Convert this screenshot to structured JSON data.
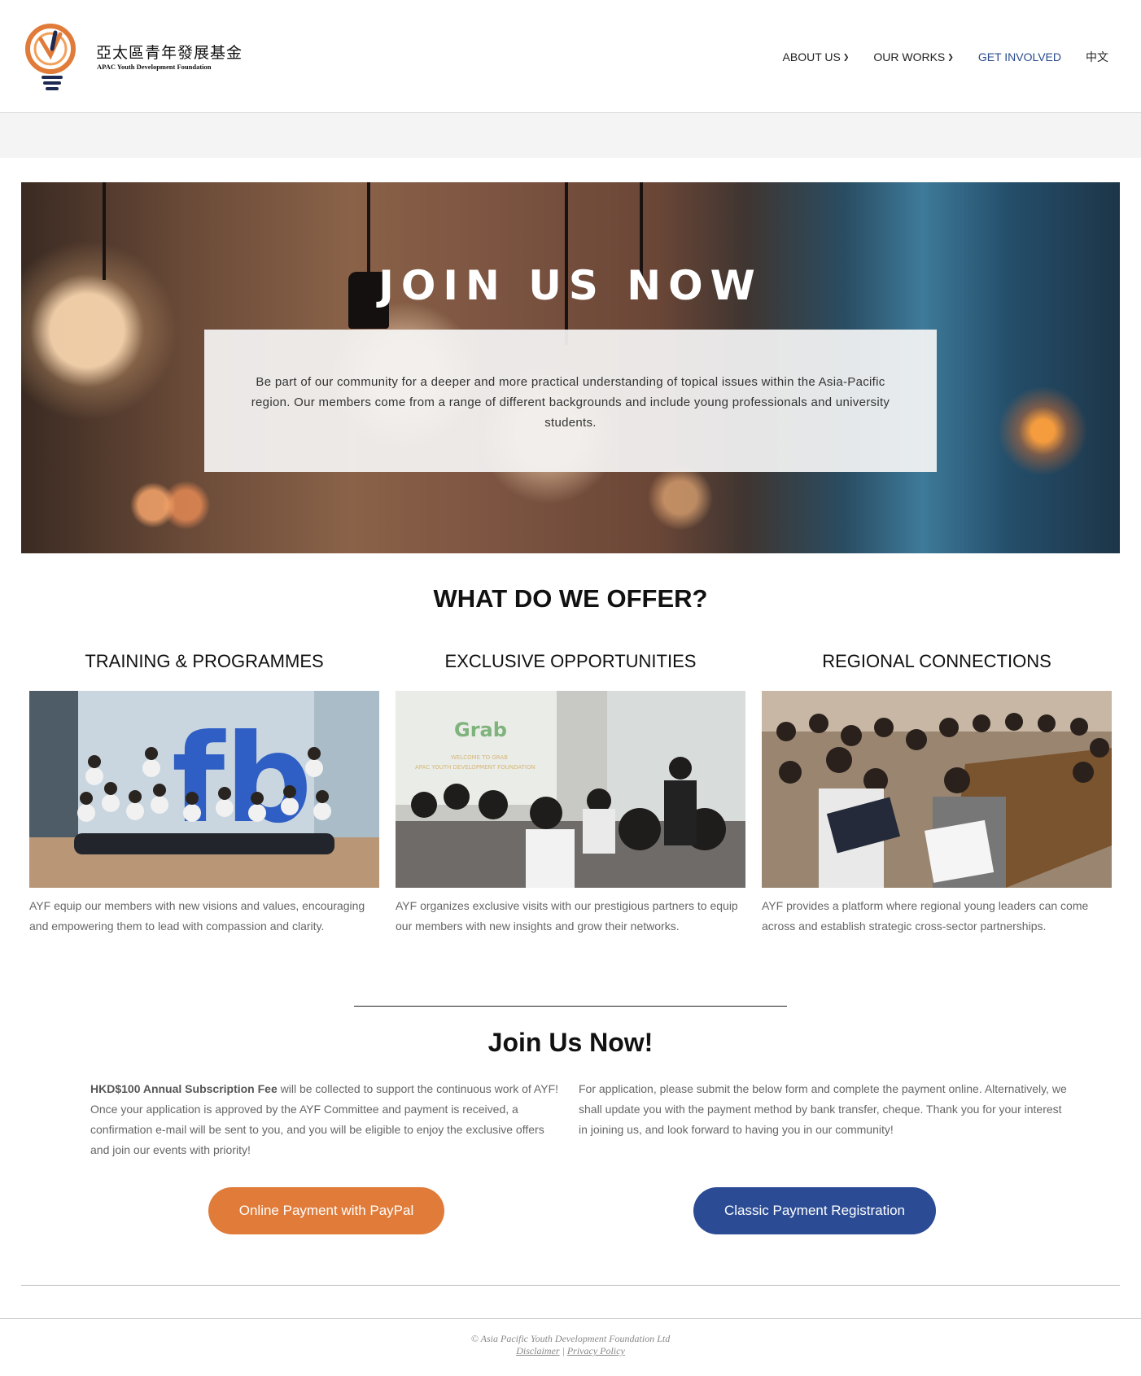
{
  "header": {
    "logo_cn": "亞太區青年發展基金",
    "logo_en": "APAC Youth Development Foundation",
    "nav": [
      {
        "label": "ABOUT US",
        "dropdown": true
      },
      {
        "label": "OUR WORKS",
        "dropdown": true
      },
      {
        "label": "GET INVOLVED",
        "dropdown": false,
        "active": true
      },
      {
        "label": "中文",
        "dropdown": false
      }
    ],
    "colors": {
      "brand_orange": "#e07b39",
      "brand_navy": "#2b4c95",
      "active_nav": "#2a4b8d"
    }
  },
  "hero": {
    "title": "JOIN US NOW",
    "text": "Be part of our community for a deeper and more practical understanding of topical issues within the Asia-Pacific region. Our members come from a range of different backgrounds and include young professionals and university students."
  },
  "offer": {
    "title": "WHAT DO WE OFFER?",
    "columns": [
      {
        "title": "TRAINING & PROGRAMMES",
        "text": "AYF equip our members with new visions and values, encouraging and empowering them to lead with compassion and clarity."
      },
      {
        "title": "EXCLUSIVE OPPORTUNITIES",
        "text": "AYF organizes exclusive visits with our prestigious partners to equip our members with new insights and grow their networks."
      },
      {
        "title": "REGIONAL CONNECTIONS",
        "text": "AYF provides a platform where regional young leaders can come across and establish strategic cross-sector partnerships."
      }
    ],
    "photo_texts": {
      "fb_sign": "fb",
      "grab_logo": "Grab",
      "grab_slide_line1": "WELCOME TO GRAB",
      "grab_slide_line2": "APAC YOUTH DEVELOPMENT FOUNDATION"
    }
  },
  "join": {
    "title": "Join Us Now!",
    "fee_bold": "HKD$100 Annual Subscription Fee",
    "left_text": " will be collected to support the continuous work of AYF! Once your application is approved by the AYF Committee and payment is received, a confirmation e-mail will be sent to you, and you will be eligible to enjoy the exclusive offers and join our events with priority!",
    "right_text": "For application, please submit the below form and complete the payment online. Alternatively, we shall update you with the payment method by bank transfer, cheque. Thank you for your interest in joining us, and look forward to having you in our community!",
    "paypal_button": "Online Payment with PayPal",
    "classic_button": "Classic Payment Registration"
  },
  "footer": {
    "copyright": "© Asia Pacific Youth Development Foundation Ltd",
    "disclaimer": "Disclaimer",
    "separator": "|",
    "privacy": "Privacy Policy"
  }
}
